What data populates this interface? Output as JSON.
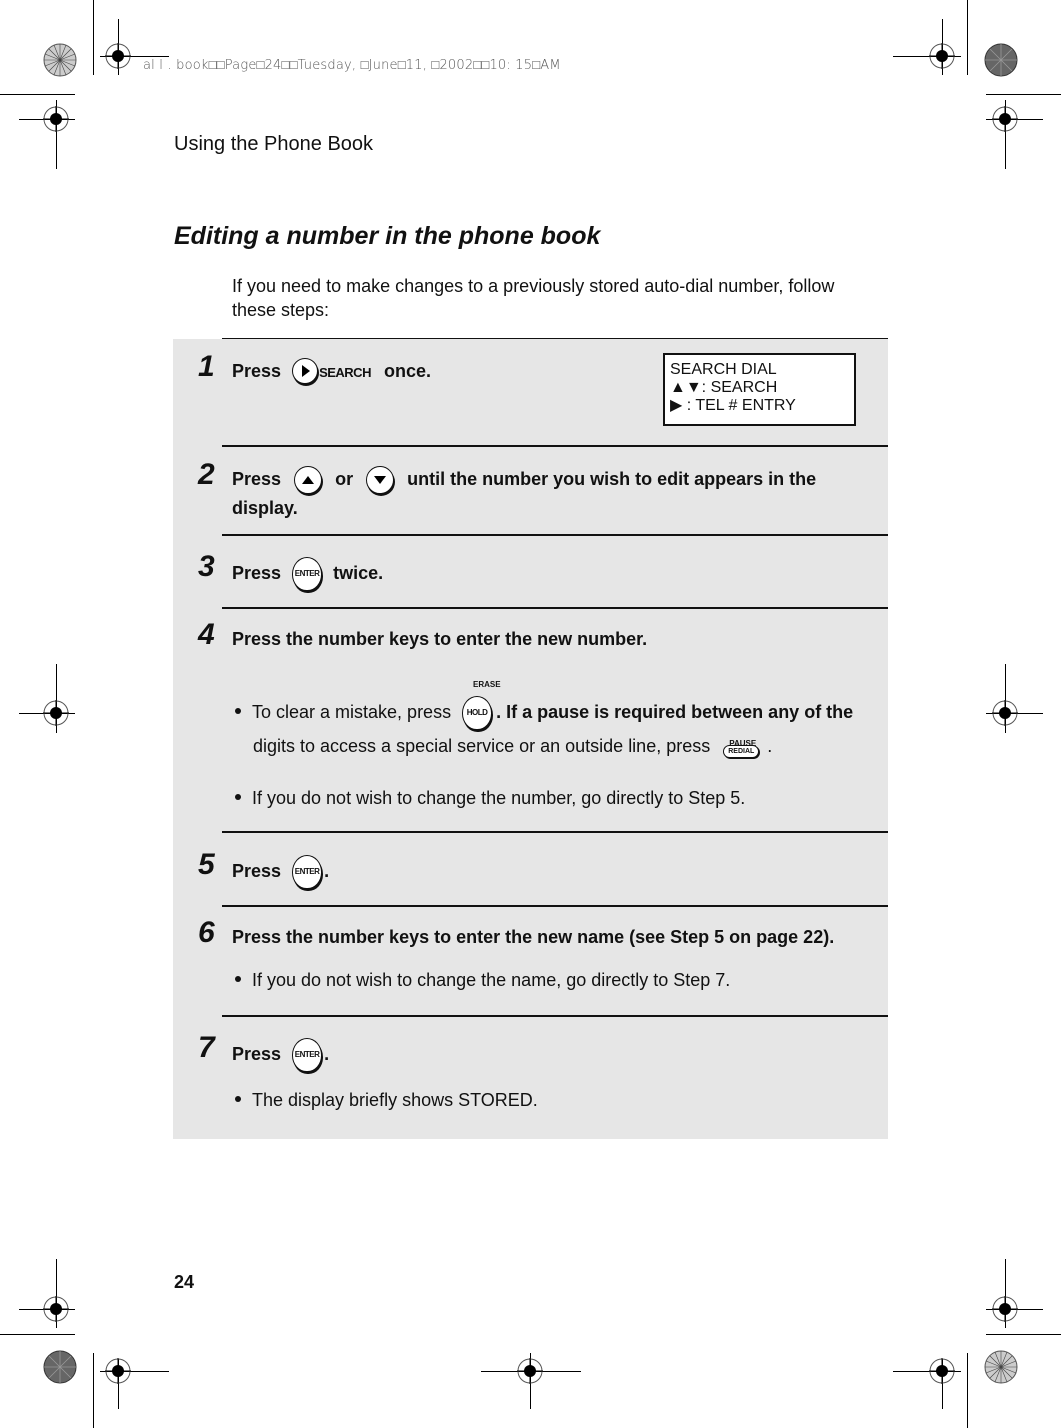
{
  "print_info": "al l . book□□Page□24□□Tuesday, □June□11, □2002□□10: 15□AM",
  "running_head": "Using the Phone Book",
  "section_title": "Editing a number in the phone book",
  "intro": "If you need to make changes to a previously stored auto-dial number, follow these steps:",
  "lcd_display": {
    "lines": [
      "SEARCH DIAL",
      "▲▼: SEARCH",
      "▶ : TEL # ENTRY"
    ]
  },
  "keys": {
    "search": "SEARCH",
    "enter": "ENTER",
    "hold": "HOLD",
    "erase": "ERASE",
    "pause": "PAUSE",
    "redial": "REDIAL"
  },
  "steps": [
    {
      "num": "1",
      "pre": "Press",
      "post": "once."
    },
    {
      "num": "2",
      "pre": "Press",
      "mid": "or",
      "post": "until the number you wish to edit appears in the",
      "post2": "display."
    },
    {
      "num": "3",
      "pre": "Press",
      "post": "twice."
    },
    {
      "num": "4",
      "text": "Press the number keys to enter the new number.",
      "bullets": [
        {
          "a": "To clear a mistake, press",
          "b": ". If a pause is required between any of the",
          "c": "digits to access a special service or an outside line, press",
          "d": "."
        },
        {
          "a": "If you do not wish to change the number, go directly to Step 5."
        }
      ]
    },
    {
      "num": "5",
      "pre": "Press",
      "post": "."
    },
    {
      "num": "6",
      "text": "Press the number keys to enter the new name (see Step 5 on page 22).",
      "bullets": [
        {
          "a": "If you do not wish to change the name, go directly to Step 7."
        }
      ]
    },
    {
      "num": "7",
      "pre": "Press",
      "post": ".",
      "bullets": [
        {
          "a": "The display briefly shows STORED."
        }
      ]
    }
  ],
  "page_number": "24"
}
